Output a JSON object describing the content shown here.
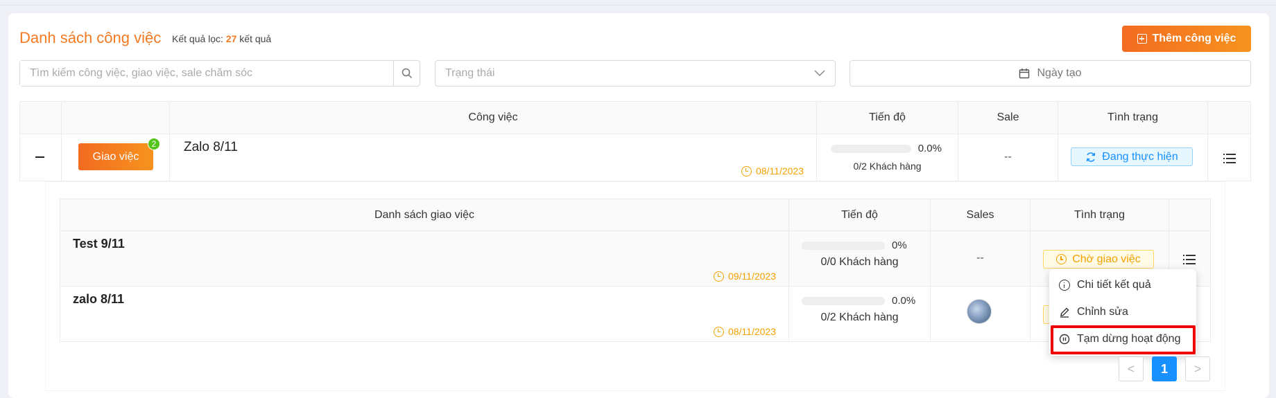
{
  "header": {
    "title": "Danh sách công việc",
    "result_prefix": "Kết quả lọc: ",
    "result_count": "27",
    "result_suffix": " kết quả",
    "add_button": "Thêm công việc"
  },
  "filters": {
    "search_placeholder": "Tìm kiếm công việc, giao việc, sale chăm sóc",
    "status_placeholder": "Trạng thái",
    "date_placeholder": "Ngày tạo"
  },
  "main_table": {
    "columns": [
      "",
      "",
      "Công việc",
      "Tiến độ",
      "Sale",
      "Tình trạng",
      ""
    ],
    "row": {
      "assign_button": "Giao việc",
      "badge": "2",
      "name": "Zalo 8/11",
      "date": "08/11/2023",
      "progress": "0.0%",
      "progress_value": 0,
      "customers": "0/2 Khách hàng",
      "sale": "--",
      "status": "Đang thực hiện"
    }
  },
  "sub_table": {
    "columns": [
      "Danh sách giao việc",
      "Tiến độ",
      "Sales",
      "Tình trạng",
      ""
    ],
    "rows": [
      {
        "name": "Test 9/11",
        "date": "09/11/2023",
        "progress": "0%",
        "progress_value": 0,
        "customers": "0/0 Khách hàng",
        "sales": "--",
        "status": "Chờ giao việc"
      },
      {
        "name": "zalo 8/11",
        "date": "08/11/2023",
        "progress": "0.0%",
        "progress_value": 0,
        "customers": "0/2 Khách hàng",
        "sales": "",
        "status": ""
      }
    ]
  },
  "action_menu": {
    "items": [
      "Chi tiết kết quả",
      "Chỉnh sửa",
      "Tạm dừng hoạt động"
    ]
  },
  "pagination": {
    "prev": "<",
    "current": "1",
    "next": ">"
  },
  "colors": {
    "accent": "#f47920",
    "primary": "#1890ff",
    "warning": "#f4a000",
    "highlight": "#e00000"
  }
}
